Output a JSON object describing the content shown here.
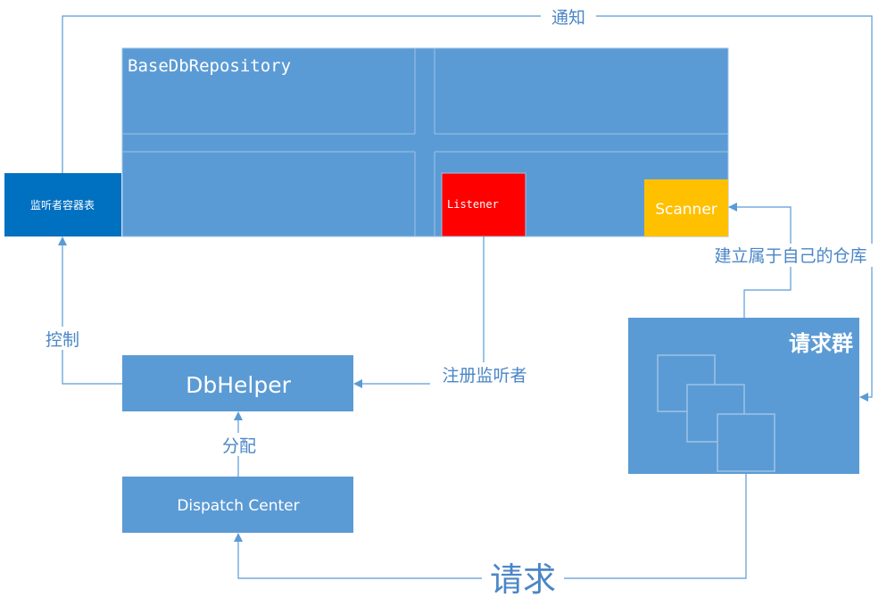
{
  "colors": {
    "block": "#5B9BD5",
    "block_border": "#9DC3E6",
    "block_dark": "#0070C0",
    "listener": "#FF0000",
    "scanner": "#FFC000",
    "line": "#5B9BD5",
    "label": "#4A86C7"
  },
  "repository": {
    "title": "BaseDbRepository"
  },
  "listener_table": {
    "label": "监听者容器表"
  },
  "listener": {
    "label": "Listener"
  },
  "scanner": {
    "label": "Scanner"
  },
  "requests_group": {
    "label": "请求群"
  },
  "db_helper": {
    "label": "DbHelper"
  },
  "dispatch_center": {
    "label": "Dispatch Center"
  },
  "edges": {
    "notify": "通知",
    "control": "控制",
    "register_listener": "注册监听者",
    "build_own_repo": "建立属于自己的仓库",
    "distribute": "分配",
    "request": "请求"
  }
}
